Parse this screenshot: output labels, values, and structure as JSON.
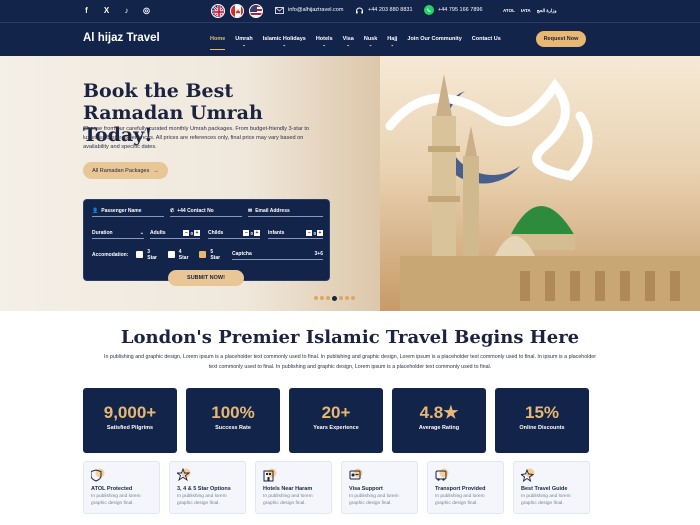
{
  "topbar": {
    "social": [
      "f",
      "X",
      "♪",
      "◎"
    ],
    "email": "info@alhijaztravel.com",
    "phone": "+44 203 880 8831",
    "whatsapp": "+44 795 166 7896",
    "accreditations": [
      "ATOL",
      "IATA",
      "وزارة الحج"
    ]
  },
  "nav": {
    "logo": "Al hijaz Travel",
    "items": [
      {
        "label": "Home",
        "chevron": ""
      },
      {
        "label": "Umrah",
        "chevron": "⌄"
      },
      {
        "label": "Islamic Holidays",
        "chevron": "⌄"
      },
      {
        "label": "Hotels",
        "chevron": "⌄"
      },
      {
        "label": "Visa",
        "chevron": "⌄"
      },
      {
        "label": "Nusk",
        "chevron": "⌄"
      },
      {
        "label": "Hajj",
        "chevron": "⌄"
      },
      {
        "label": "Join Our Community",
        "chevron": ""
      },
      {
        "label": "Contact Us",
        "chevron": ""
      }
    ],
    "request_btn": "Request Now"
  },
  "hero": {
    "title": "Book the Best Ramadan Umrah Today!",
    "desc": "Choose from our carefully curated monthly Umrah packages. From budget-friendly 3-star to luxurious 5-star experiences. All prices are references only, final price may vary based on availability and specific dates.",
    "packages_btn": "All Ramadan Packages",
    "form": {
      "passenger": "Passenger Name",
      "contact": "+44 Contact No",
      "email": "Email Address",
      "duration": "Duration",
      "adults": "Adults",
      "childs": "Childs",
      "infants": "Infants",
      "count": "0",
      "accommodation": "Accomodation:",
      "star3": "3 Star",
      "star4": "4 Star",
      "star5": "5 Star",
      "captcha": "Captcha",
      "captcha_value": "3+6",
      "submit": "SUBMIT NOW!"
    }
  },
  "section": {
    "title": "London's Premier Islamic Travel Begins Here",
    "desc": "In publishing and graphic design, Lorem ipsum is a placeholder text commonly used to final. In publishing and graphic design, Lorem ipsum is a placeholder text commonly used to final. In ipsum is a placeholder text commonly used to final. In publishing and graphic design, Lorem ipsum is a placeholder text commonly used to final."
  },
  "stats": [
    {
      "num": "9,000+",
      "label": "Satisfied Pilgrims"
    },
    {
      "num": "100%",
      "label": "Success Rate"
    },
    {
      "num": "20+",
      "label": "Years Experience"
    },
    {
      "num": "4.8★",
      "label": "Average Rating"
    },
    {
      "num": "15%",
      "label": "Online Discounts"
    }
  ],
  "features": [
    {
      "title": "ATOL Protected",
      "desc": "In publishing and lorem graphic design final.",
      "icon": "shield-icon"
    },
    {
      "title": "3, 4 & 5 Star Options",
      "desc": "In publishing and lorem graphic design final.",
      "icon": "star-icon"
    },
    {
      "title": "Hotels Near Haram",
      "desc": "In publishing and lorem graphic design final.",
      "icon": "hotel-icon"
    },
    {
      "title": "Visa Support",
      "desc": "In publishing and lorem graphic design final.",
      "icon": "visa-icon"
    },
    {
      "title": "Transport Provided",
      "desc": "In publishing and lorem graphic design final.",
      "icon": "bus-icon"
    },
    {
      "title": "Best Travel Guide",
      "desc": "In publishing and lorem graphic design final.",
      "icon": "guide-icon"
    }
  ],
  "colors": {
    "navy": "#12244a",
    "gold": "#e8b873"
  }
}
